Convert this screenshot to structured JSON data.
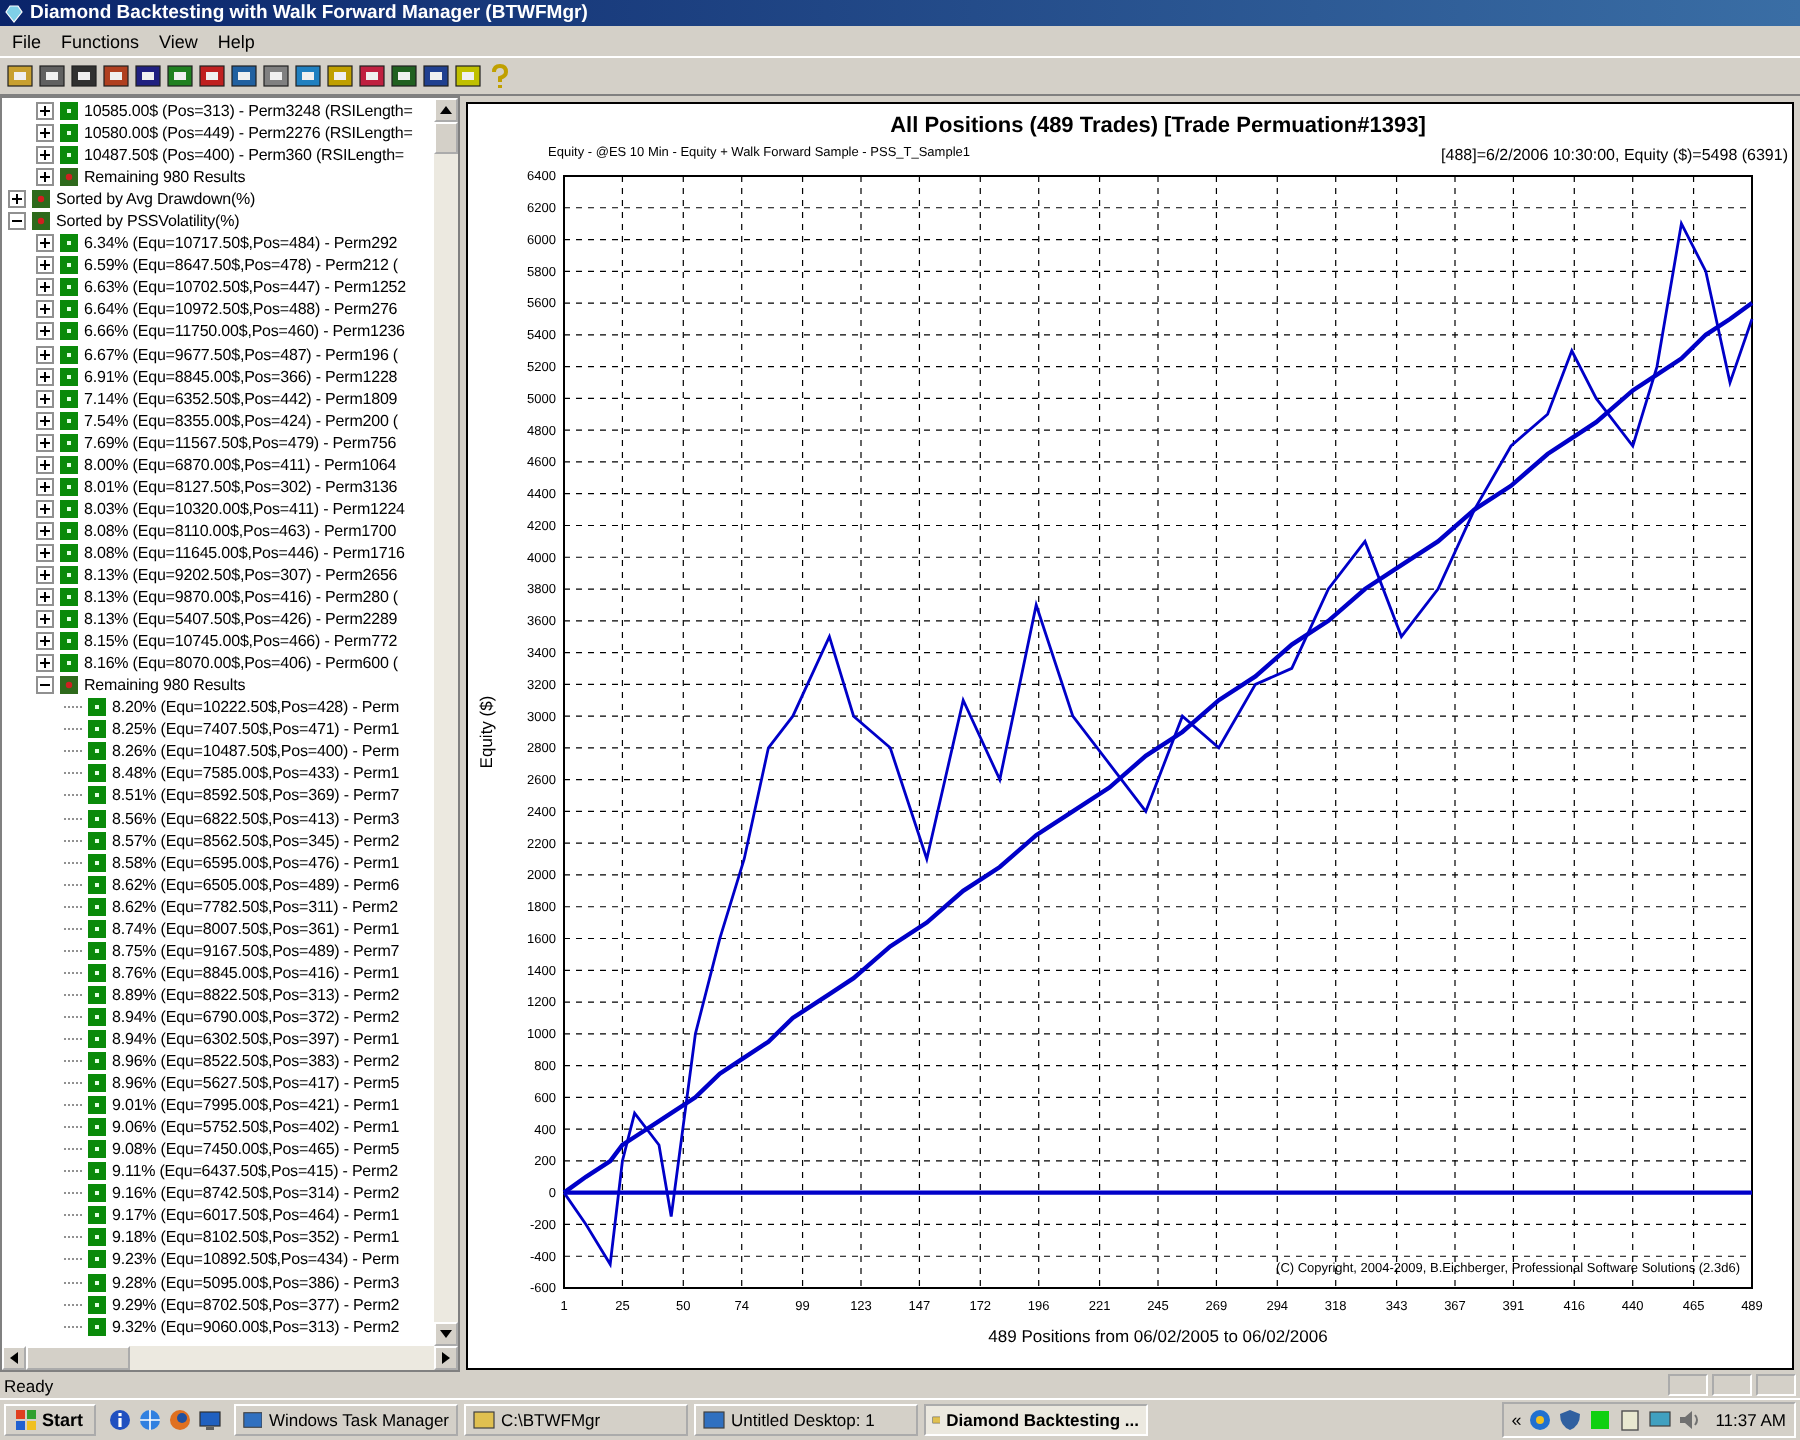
{
  "window": {
    "title": "Diamond Backtesting with Walk Forward Manager (BTWFMgr)"
  },
  "menu": [
    "File",
    "Functions",
    "View",
    "Help"
  ],
  "tree": {
    "nodes": [
      {
        "children": [
          {
            "label": "10585.00$ (Pos=313) - Perm3248 (RSILength=",
            "kind": "result",
            "expanded": false
          },
          {
            "label": "10580.00$ (Pos=449) - Perm2276 (RSILength=",
            "kind": "result",
            "expanded": false
          },
          {
            "label": "10487.50$ (Pos=400) - Perm360 (RSILength=",
            "kind": "result",
            "expanded": false
          },
          {
            "label": "Remaining 980 Results",
            "kind": "group",
            "expanded": false
          }
        ]
      },
      {
        "label": "Sorted by Avg Drawdown(%)",
        "kind": "group",
        "expanded": false
      },
      {
        "label": "Sorted by PSSVolatility(%)",
        "kind": "group",
        "expanded": true,
        "children": [
          {
            "label": "6.34% (Equ=10717.50$,Pos=484) - Perm292",
            "kind": "result",
            "expanded": false
          },
          {
            "label": "6.59% (Equ=8647.50$,Pos=478) - Perm212 (",
            "kind": "result",
            "expanded": false
          },
          {
            "label": "6.63% (Equ=10702.50$,Pos=447) - Perm1252",
            "kind": "result",
            "expanded": false
          },
          {
            "label": "6.64% (Equ=10972.50$,Pos=488) - Perm276",
            "kind": "result",
            "expanded": false
          },
          {
            "label": "6.66% (Equ=11750.00$,Pos=460) - Perm1236",
            "kind": "result",
            "expanded": false
          },
          {
            "label": "6.67% (Equ=9677.50$,Pos=487) - Perm196 (",
            "kind": "result",
            "expanded": false
          },
          {
            "label": "6.91% (Equ=8845.00$,Pos=366) - Perm1228",
            "kind": "result",
            "expanded": false
          },
          {
            "label": "7.14% (Equ=6352.50$,Pos=442) - Perm1809",
            "kind": "result",
            "expanded": false
          },
          {
            "label": "7.54% (Equ=8355.00$,Pos=424) - Perm200 (",
            "kind": "result",
            "expanded": false
          },
          {
            "label": "7.69% (Equ=11567.50$,Pos=479) - Perm756",
            "kind": "result",
            "expanded": false
          },
          {
            "label": "8.00% (Equ=6870.00$,Pos=411) - Perm1064",
            "kind": "result",
            "expanded": false
          },
          {
            "label": "8.01% (Equ=8127.50$,Pos=302) - Perm3136",
            "kind": "result",
            "expanded": false
          },
          {
            "label": "8.03% (Equ=10320.00$,Pos=411) - Perm1224",
            "kind": "result",
            "expanded": false
          },
          {
            "label": "8.08% (Equ=8110.00$,Pos=463) - Perm1700",
            "kind": "result",
            "expanded": false
          },
          {
            "label": "8.08% (Equ=11645.00$,Pos=446) - Perm1716",
            "kind": "result",
            "expanded": false
          },
          {
            "label": "8.13% (Equ=9202.50$,Pos=307) - Perm2656",
            "kind": "result",
            "expanded": false
          },
          {
            "label": "8.13% (Equ=9870.00$,Pos=416) - Perm280 (",
            "kind": "result",
            "expanded": false
          },
          {
            "label": "8.13% (Equ=5407.50$,Pos=426) - Perm2289",
            "kind": "result",
            "expanded": false
          },
          {
            "label": "8.15% (Equ=10745.00$,Pos=466) - Perm772",
            "kind": "result",
            "expanded": false
          },
          {
            "label": "8.16% (Equ=8070.00$,Pos=406) - Perm600 (",
            "kind": "result",
            "expanded": false
          },
          {
            "label": "Remaining 980 Results",
            "kind": "group",
            "expanded": true,
            "children": [
              {
                "label": "8.20% (Equ=10222.50$,Pos=428) - Perm",
                "kind": "result"
              },
              {
                "label": "8.25% (Equ=7407.50$,Pos=471) - Perm1",
                "kind": "result"
              },
              {
                "label": "8.26% (Equ=10487.50$,Pos=400) - Perm",
                "kind": "result"
              },
              {
                "label": "8.48% (Equ=7585.00$,Pos=433) - Perm1",
                "kind": "result"
              },
              {
                "label": "8.51% (Equ=8592.50$,Pos=369) - Perm7",
                "kind": "result"
              },
              {
                "label": "8.56% (Equ=6822.50$,Pos=413) - Perm3",
                "kind": "result"
              },
              {
                "label": "8.57% (Equ=8562.50$,Pos=345) - Perm2",
                "kind": "result"
              },
              {
                "label": "8.58% (Equ=6595.00$,Pos=476) - Perm1",
                "kind": "result"
              },
              {
                "label": "8.62% (Equ=6505.00$,Pos=489) - Perm6",
                "kind": "result"
              },
              {
                "label": "8.62% (Equ=7782.50$,Pos=311) - Perm2",
                "kind": "result"
              },
              {
                "label": "8.74% (Equ=8007.50$,Pos=361) - Perm1",
                "kind": "result"
              },
              {
                "label": "8.75% (Equ=9167.50$,Pos=489) - Perm7",
                "kind": "result"
              },
              {
                "label": "8.76% (Equ=8845.00$,Pos=416) - Perm1",
                "kind": "result"
              },
              {
                "label": "8.89% (Equ=8822.50$,Pos=313) - Perm2",
                "kind": "result"
              },
              {
                "label": "8.94% (Equ=6790.00$,Pos=372) - Perm2",
                "kind": "result"
              },
              {
                "label": "8.94% (Equ=6302.50$,Pos=397) - Perm1",
                "kind": "result"
              },
              {
                "label": "8.96% (Equ=8522.50$,Pos=383) - Perm2",
                "kind": "result"
              },
              {
                "label": "8.96% (Equ=5627.50$,Pos=417) - Perm5",
                "kind": "result"
              },
              {
                "label": "9.01% (Equ=7995.00$,Pos=421) - Perm1",
                "kind": "result"
              },
              {
                "label": "9.06% (Equ=5752.50$,Pos=402) - Perm1",
                "kind": "result"
              },
              {
                "label": "9.08% (Equ=7450.00$,Pos=465) - Perm5",
                "kind": "result"
              },
              {
                "label": "9.11% (Equ=6437.50$,Pos=415) - Perm2",
                "kind": "result"
              },
              {
                "label": "9.16% (Equ=8742.50$,Pos=314) - Perm2",
                "kind": "result"
              },
              {
                "label": "9.17% (Equ=6017.50$,Pos=464) - Perm1",
                "kind": "result"
              },
              {
                "label": "9.18% (Equ=8102.50$,Pos=352) - Perm1",
                "kind": "result"
              },
              {
                "label": "9.23% (Equ=10892.50$,Pos=434) - Perm",
                "kind": "result"
              },
              {
                "label": "9.28% (Equ=5095.00$,Pos=386) - Perm3",
                "kind": "result"
              },
              {
                "label": "9.29% (Equ=8702.50$,Pos=377) - Perm2",
                "kind": "result"
              },
              {
                "label": "9.32% (Equ=9060.00$,Pos=313) - Perm2",
                "kind": "result"
              }
            ]
          }
        ]
      }
    ]
  },
  "chart": {
    "subtitle": "Equity - @ES 10 Min - Equity + Walk Forward Sample - PSS_T_Sample1",
    "reading": "[488]=6/2/2006 10:30:00,   Equity ($)=5498 (6391)",
    "copyright": "(C) Copyright, 2004-2009, B.Eichberger, Professional Software Solutions (2.3d6)",
    "chart_data": {
      "type": "line",
      "title": "All Positions (489 Trades) [Trade Permuation#1393]",
      "xlabel": "489 Positions from 06/02/2005 to 06/02/2006",
      "ylabel": "Equity ($)",
      "x": [
        1,
        10,
        20,
        25,
        30,
        40,
        45,
        55,
        65,
        75,
        85,
        95,
        110,
        120,
        135,
        150,
        165,
        180,
        195,
        210,
        225,
        240,
        255,
        270,
        285,
        300,
        315,
        330,
        345,
        360,
        375,
        390,
        405,
        415,
        425,
        440,
        450,
        460,
        470,
        480,
        489
      ],
      "series": [
        {
          "color": "#0000c8",
          "values": [
            0,
            -200,
            -450,
            200,
            500,
            300,
            -150,
            1000,
            1600,
            2100,
            2800,
            3000,
            3500,
            3000,
            2800,
            2100,
            3100,
            2600,
            3700,
            3000,
            2700,
            2400,
            3000,
            2800,
            3200,
            3300,
            3800,
            4100,
            3500,
            3800,
            4300,
            4700,
            4900,
            5300,
            5000,
            4700,
            5200,
            6100,
            5800,
            5100,
            5500
          ]
        },
        {
          "color": "#0000c8",
          "values": [
            0,
            100,
            200,
            300,
            350,
            450,
            500,
            600,
            750,
            850,
            950,
            1100,
            1250,
            1350,
            1550,
            1700,
            1900,
            2050,
            2250,
            2400,
            2550,
            2750,
            2900,
            3100,
            3250,
            3450,
            3600,
            3800,
            3950,
            4100,
            4300,
            4450,
            4650,
            4750,
            4850,
            5050,
            5150,
            5250,
            5400,
            5500,
            5600
          ]
        },
        {
          "color": "#0000c8",
          "values": [
            0,
            0,
            0,
            0,
            0,
            0,
            0,
            0,
            0,
            0,
            0,
            0,
            0,
            0,
            0,
            0,
            0,
            0,
            0,
            0,
            0,
            0,
            0,
            0,
            0,
            0,
            0,
            0,
            0,
            0,
            0,
            0,
            0,
            0,
            0,
            0,
            0,
            0,
            0,
            0,
            0
          ]
        }
      ],
      "grid": true,
      "xlim": [
        1,
        489
      ],
      "ylim": [
        -600,
        6400
      ],
      "xticks": [
        1,
        25,
        50,
        74,
        99,
        123,
        147,
        172,
        196,
        221,
        245,
        269,
        294,
        318,
        343,
        367,
        391,
        416,
        440,
        465,
        489
      ],
      "yticks": [
        -600,
        -400,
        -200,
        0,
        200,
        400,
        600,
        800,
        1000,
        1200,
        1400,
        1600,
        1800,
        2000,
        2200,
        2400,
        2600,
        2800,
        3000,
        3200,
        3400,
        3600,
        3800,
        4000,
        4200,
        4400,
        4600,
        4800,
        5000,
        5200,
        5400,
        5600,
        5800,
        6000,
        6200,
        6400
      ]
    }
  },
  "status_bar": "Ready",
  "taskbar": {
    "start": "Start",
    "tasks": [
      {
        "label": "Windows Task Manager",
        "selected": false
      },
      {
        "label": "C:\\BTWFMgr",
        "selected": false
      },
      {
        "label": "Untitled Desktop: 1",
        "selected": false
      },
      {
        "label": "Diamond Backtesting ...",
        "selected": true
      }
    ],
    "tray_toggle": "«",
    "clock": "11:37 AM"
  }
}
